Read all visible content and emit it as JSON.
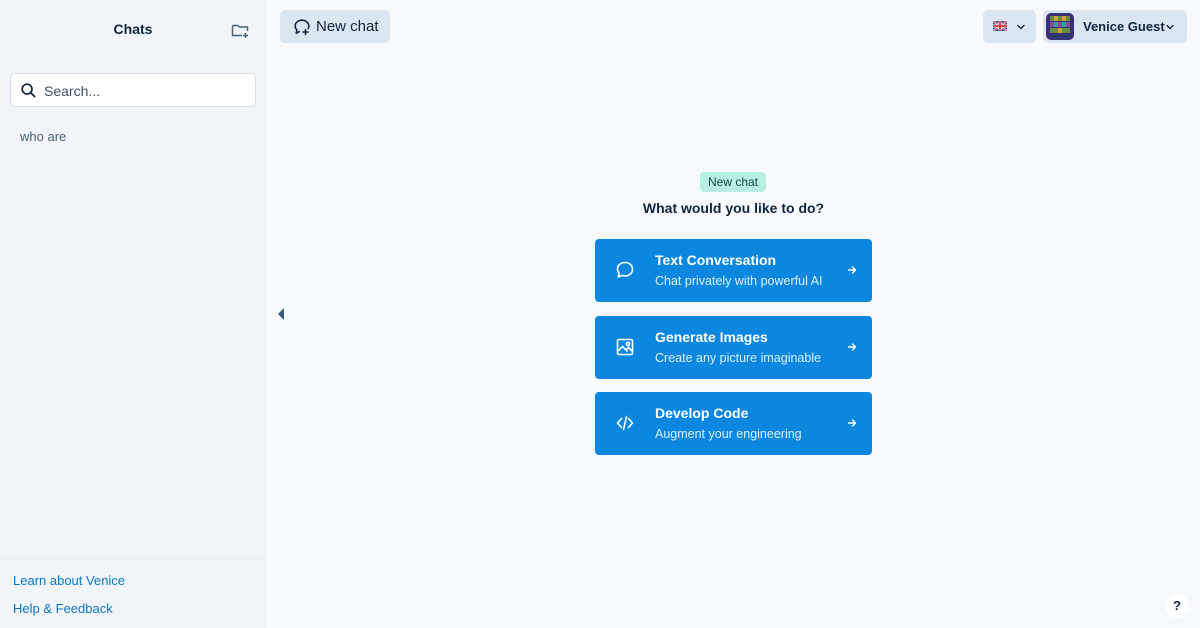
{
  "sidebar": {
    "title": "Chats",
    "search_placeholder": "Search...",
    "chats": [
      "who are"
    ],
    "footer_links": [
      "Learn about Venice",
      "Help & Feedback"
    ]
  },
  "header": {
    "new_chat_label": "New chat",
    "language_flag": "uk-flag-icon",
    "user_name": "Venice Guest"
  },
  "main": {
    "badge": "New chat",
    "prompt": "What would you like to do?",
    "options": [
      {
        "title": "Text Conversation",
        "subtitle": "Chat privately with powerful AI",
        "icon": "chat-bubble-icon"
      },
      {
        "title": "Generate Images",
        "subtitle": "Create any picture imaginable",
        "icon": "image-icon"
      },
      {
        "title": "Develop Code",
        "subtitle": "Augment your engineering",
        "icon": "code-icon"
      }
    ]
  },
  "help_label": "?",
  "colors": {
    "accent": "#0b87e0",
    "badge_bg": "#b8efe4",
    "button_bg": "#dbe6f0",
    "link": "#0b74c4"
  }
}
